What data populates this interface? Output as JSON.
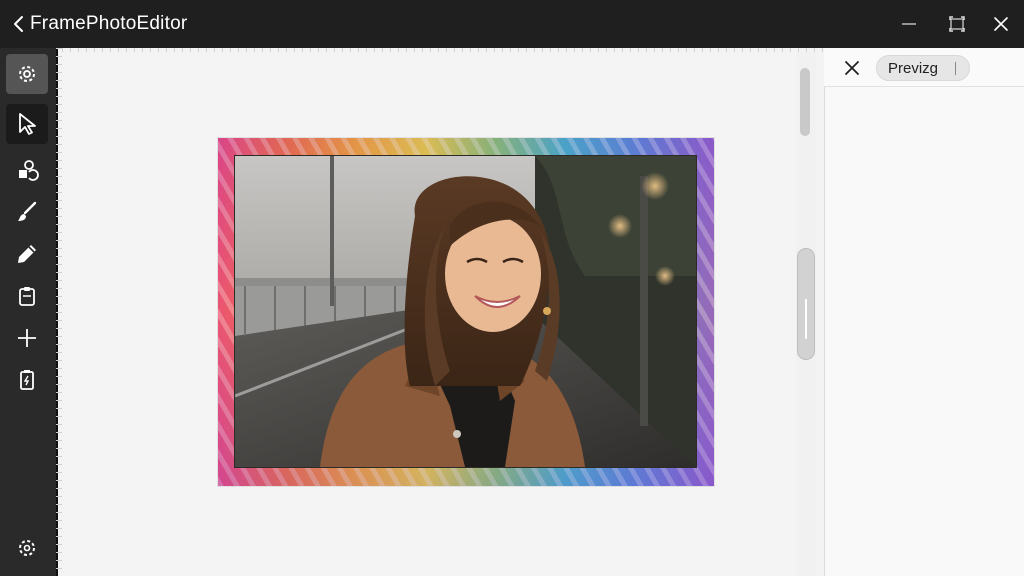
{
  "app": {
    "title": "FramePhotoEditor"
  },
  "window_controls": [
    "minimize",
    "maximize",
    "close"
  ],
  "toolbar": {
    "items": [
      {
        "icon": "settings-gear-icon",
        "state": "highlighted"
      },
      {
        "icon": "select-arrow-icon",
        "state": "selected"
      },
      {
        "icon": "shapes-icon"
      },
      {
        "icon": "brush-icon"
      },
      {
        "icon": "pencil-icon"
      },
      {
        "icon": "clipboard-icon"
      },
      {
        "icon": "plus-icon"
      },
      {
        "icon": "battery-document-icon"
      },
      {
        "icon": "settings-gear-icon"
      }
    ]
  },
  "panel": {
    "preview_label": "Previzg"
  },
  "colors": {
    "titlebar": "#1f1f1f",
    "toolbar": "#2a2a2a",
    "canvas": "#f4f4f4",
    "panel": "#f9f9f9"
  }
}
